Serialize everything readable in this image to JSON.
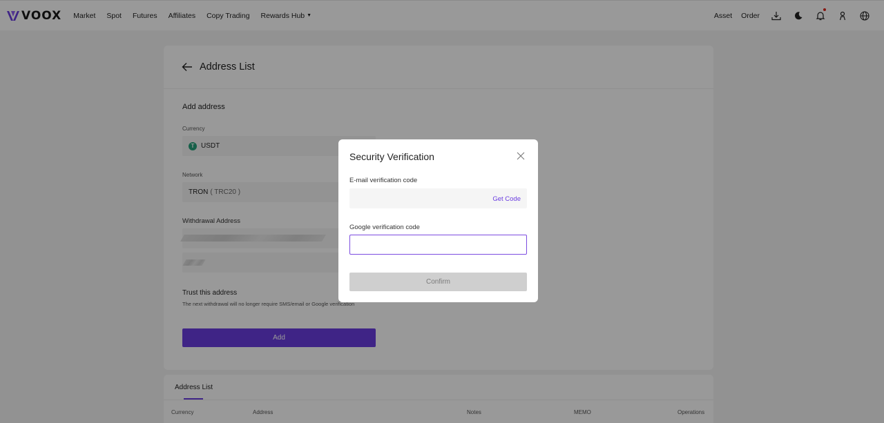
{
  "nav": {
    "brand": "VOOX",
    "links": [
      "Market",
      "Spot",
      "Futures",
      "Affiliates",
      "Copy Trading",
      "Rewards Hub"
    ],
    "asset": "Asset",
    "order": "Order",
    "icons": [
      "download-icon",
      "moon-icon",
      "bell-icon",
      "user-icon",
      "globe-icon"
    ]
  },
  "page": {
    "title": "Address List",
    "section_title": "Add address",
    "currency_label": "Currency",
    "currency_value": "USDT",
    "currency_icon_letter": "T",
    "network_label": "Network",
    "network_value": "TRON",
    "network_sub": "( TRC20 )",
    "address_label": "Withdrawal Address",
    "trust_title": "Trust this address",
    "trust_desc": "The next withdrawal will no longer require SMS/email or Google verification",
    "add_button": "Add"
  },
  "list": {
    "tab": "Address List",
    "columns": [
      "Currency",
      "Address",
      "Notes",
      "MEMO",
      "Operations"
    ]
  },
  "modal": {
    "title": "Security Verification",
    "email_label": "E-mail verification code",
    "email_value": "",
    "get_code": "Get Code",
    "google_label": "Google verification code",
    "google_value": "",
    "confirm": "Confirm"
  },
  "colors": {
    "accent": "#6a3ce0",
    "overlay": "rgba(0,0,0,0.4)",
    "usdt": "#26a17b",
    "notification_dot": "#e0251c"
  }
}
